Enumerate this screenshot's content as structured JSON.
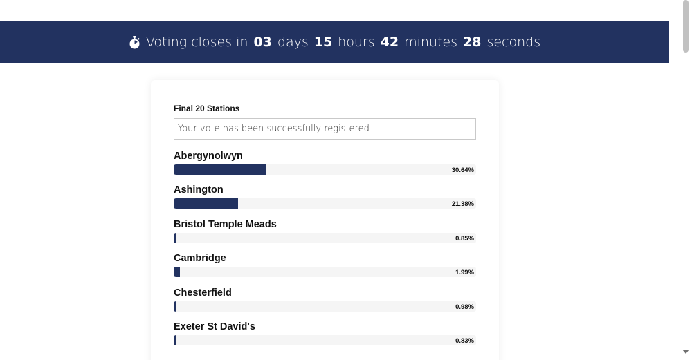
{
  "countdown": {
    "lead": "Voting closes in",
    "days_value": "03",
    "days_unit": "days",
    "hours_value": "15",
    "hours_unit": "hours",
    "minutes_value": "42",
    "minutes_unit": "minutes",
    "seconds_value": "28",
    "seconds_unit": "seconds",
    "icon": "stopwatch-icon"
  },
  "poll": {
    "title": "Final 20 Stations",
    "status_message": "Your vote has been successfully registered.",
    "results": [
      {
        "name": "Abergynolwyn",
        "percent_label": "30.64%",
        "percent": 30.64
      },
      {
        "name": "Ashington",
        "percent_label": "21.38%",
        "percent": 21.38
      },
      {
        "name": "Bristol Temple Meads",
        "percent_label": "0.85%",
        "percent": 0.85
      },
      {
        "name": "Cambridge",
        "percent_label": "1.99%",
        "percent": 1.99
      },
      {
        "name": "Chesterfield",
        "percent_label": "0.98%",
        "percent": 0.98
      },
      {
        "name": "Exeter St David's",
        "percent_label": "0.83%",
        "percent": 0.83
      }
    ]
  },
  "colors": {
    "banner_bg": "#223260",
    "bar_fill": "#223260",
    "bar_track": "#f5f5f5"
  }
}
